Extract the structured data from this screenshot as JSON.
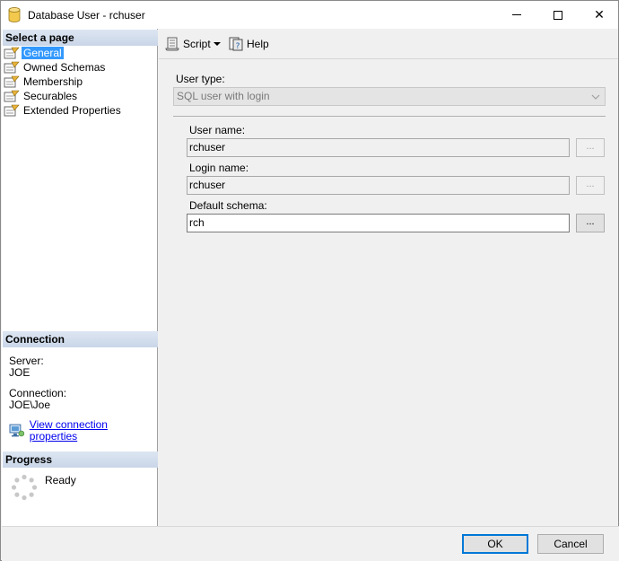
{
  "window": {
    "title": "Database User - rchuser",
    "controls": {
      "minimize": "minimize",
      "maximize": "maximize",
      "close": "✕"
    }
  },
  "left": {
    "select_page_header": "Select a page",
    "pages": [
      {
        "label": "General",
        "selected": true
      },
      {
        "label": "Owned Schemas",
        "selected": false
      },
      {
        "label": "Membership",
        "selected": false
      },
      {
        "label": "Securables",
        "selected": false
      },
      {
        "label": "Extended Properties",
        "selected": false
      }
    ],
    "connection_header": "Connection",
    "server_label": "Server:",
    "server_value": "JOE",
    "connection_label": "Connection:",
    "connection_value": "JOE\\Joe",
    "view_connection_link": "View connection properties",
    "progress_header": "Progress",
    "progress_status": "Ready"
  },
  "toolbar": {
    "script_label": "Script",
    "help_label": "Help"
  },
  "form": {
    "user_type_label": "User type:",
    "user_type_value": "SQL user with login",
    "user_name_label": "User name:",
    "user_name_value": "rchuser",
    "login_name_label": "Login name:",
    "login_name_value": "rchuser",
    "default_schema_label": "Default schema:",
    "default_schema_value": "rch",
    "ellipsis": "..."
  },
  "footer": {
    "ok_label": "OK",
    "cancel_label": "Cancel"
  },
  "colors": {
    "selection": "#3399ff",
    "header_band": "#c9d6e8",
    "default_button_border": "#0078d7",
    "link": "#0000ee"
  }
}
